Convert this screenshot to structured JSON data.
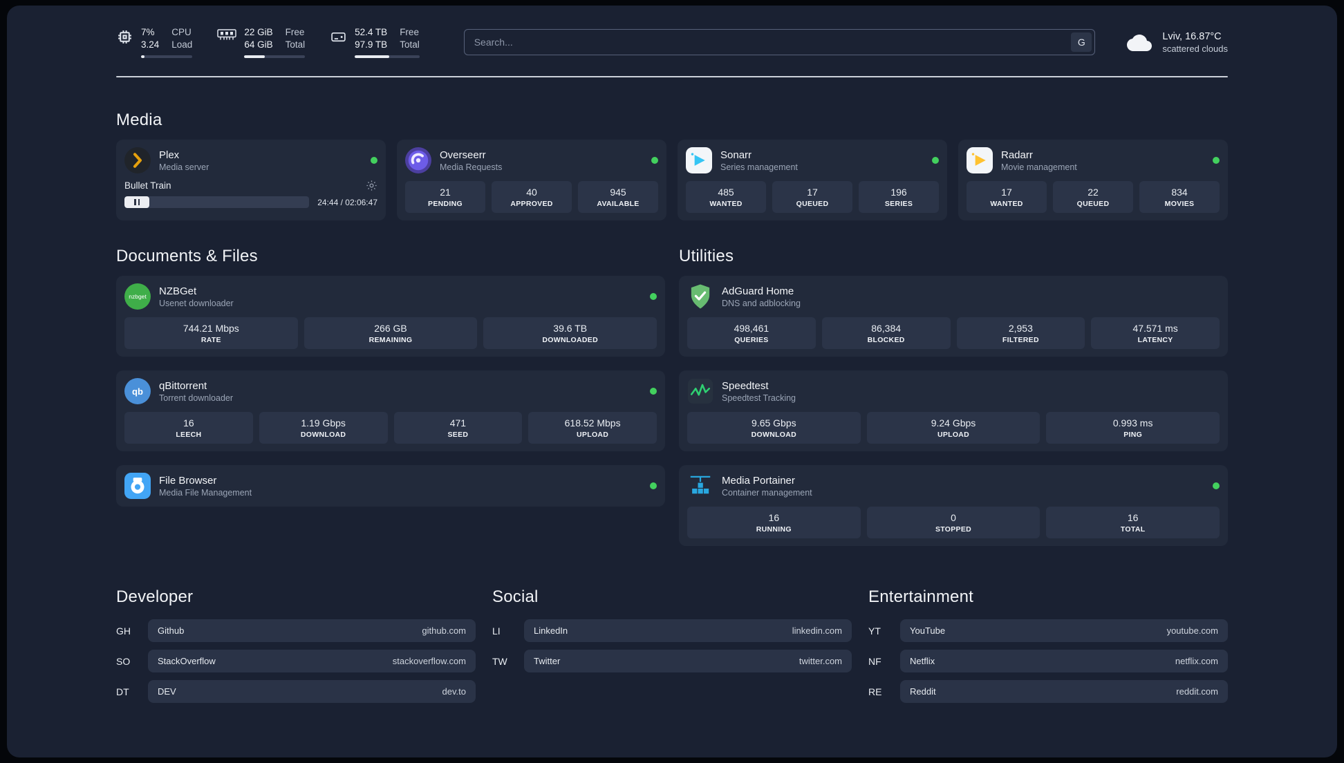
{
  "header": {
    "cpu": {
      "value1": "7%",
      "value2": "3.24",
      "label1": "CPU",
      "label2": "Load",
      "bar_percent": 7
    },
    "ram": {
      "value1": "22 GiB",
      "value2": "64 GiB",
      "label1": "Free",
      "label2": "Total",
      "bar_percent": 34
    },
    "disk": {
      "value1": "52.4 TB",
      "value2": "97.9 TB",
      "label1": "Free",
      "label2": "Total",
      "bar_percent": 53
    },
    "search": {
      "placeholder": "Search...",
      "button_label": "G"
    },
    "weather": {
      "location": "Lviv, 16.87°C",
      "condition": "scattered clouds"
    }
  },
  "media": {
    "title": "Media",
    "plex": {
      "name": "Plex",
      "subtitle": "Media server",
      "now_playing": "Bullet Train",
      "time": "24:44 / 02:06:47"
    },
    "overseerr": {
      "name": "Overseerr",
      "subtitle": "Media Requests",
      "stats": [
        {
          "value": "21",
          "label": "PENDING"
        },
        {
          "value": "40",
          "label": "APPROVED"
        },
        {
          "value": "945",
          "label": "AVAILABLE"
        }
      ]
    },
    "sonarr": {
      "name": "Sonarr",
      "subtitle": "Series management",
      "stats": [
        {
          "value": "485",
          "label": "WANTED"
        },
        {
          "value": "17",
          "label": "QUEUED"
        },
        {
          "value": "196",
          "label": "SERIES"
        }
      ]
    },
    "radarr": {
      "name": "Radarr",
      "subtitle": "Movie management",
      "stats": [
        {
          "value": "17",
          "label": "WANTED"
        },
        {
          "value": "22",
          "label": "QUEUED"
        },
        {
          "value": "834",
          "label": "MOVIES"
        }
      ]
    }
  },
  "documents": {
    "title": "Documents & Files",
    "nzbget": {
      "name": "NZBGet",
      "subtitle": "Usenet downloader",
      "icon_text": "nzbget",
      "stats": [
        {
          "value": "744.21 Mbps",
          "label": "RATE"
        },
        {
          "value": "266 GB",
          "label": "REMAINING"
        },
        {
          "value": "39.6 TB",
          "label": "DOWNLOADED"
        }
      ]
    },
    "qbittorrent": {
      "name": "qBittorrent",
      "subtitle": "Torrent downloader",
      "icon_text": "qb",
      "stats": [
        {
          "value": "16",
          "label": "LEECH"
        },
        {
          "value": "1.19 Gbps",
          "label": "DOWNLOAD"
        },
        {
          "value": "471",
          "label": "SEED"
        },
        {
          "value": "618.52 Mbps",
          "label": "UPLOAD"
        }
      ]
    },
    "filebrowser": {
      "name": "File Browser",
      "subtitle": "Media File Management"
    }
  },
  "utilities": {
    "title": "Utilities",
    "adguard": {
      "name": "AdGuard Home",
      "subtitle": "DNS and adblocking",
      "stats": [
        {
          "value": "498,461",
          "label": "QUERIES"
        },
        {
          "value": "86,384",
          "label": "BLOCKED"
        },
        {
          "value": "2,953",
          "label": "FILTERED"
        },
        {
          "value": "47.571 ms",
          "label": "LATENCY"
        }
      ]
    },
    "speedtest": {
      "name": "Speedtest",
      "subtitle": "Speedtest Tracking",
      "stats": [
        {
          "value": "9.65 Gbps",
          "label": "DOWNLOAD"
        },
        {
          "value": "9.24 Gbps",
          "label": "UPLOAD"
        },
        {
          "value": "0.993 ms",
          "label": "PING"
        }
      ]
    },
    "portainer": {
      "name": "Media Portainer",
      "subtitle": "Container management",
      "stats": [
        {
          "value": "16",
          "label": "RUNNING"
        },
        {
          "value": "0",
          "label": "STOPPED"
        },
        {
          "value": "16",
          "label": "TOTAL"
        }
      ]
    }
  },
  "bookmarks": {
    "developer": {
      "title": "Developer",
      "items": [
        {
          "abbr": "GH",
          "name": "Github",
          "url": "github.com"
        },
        {
          "abbr": "SO",
          "name": "StackOverflow",
          "url": "stackoverflow.com"
        },
        {
          "abbr": "DT",
          "name": "DEV",
          "url": "dev.to"
        }
      ]
    },
    "social": {
      "title": "Social",
      "items": [
        {
          "abbr": "LI",
          "name": "LinkedIn",
          "url": "linkedin.com"
        },
        {
          "abbr": "TW",
          "name": "Twitter",
          "url": "twitter.com"
        }
      ]
    },
    "entertainment": {
      "title": "Entertainment",
      "items": [
        {
          "abbr": "YT",
          "name": "YouTube",
          "url": "youtube.com"
        },
        {
          "abbr": "NF",
          "name": "Netflix",
          "url": "netflix.com"
        },
        {
          "abbr": "RE",
          "name": "Reddit",
          "url": "reddit.com"
        }
      ]
    }
  },
  "colors": {
    "status_online": "#43d05e",
    "plex_gold": "#e5a00d",
    "sonarr_blue": "#35c5f4",
    "radarr_yellow": "#ffc230",
    "nzbget_green": "#3fae49",
    "qbittorrent_blue": "#4a90d9",
    "adguard_green": "#68bc71",
    "speedtest_green": "#2fd072",
    "portainer_blue": "#29a8e0",
    "filebrowser_blue": "#42a5f5",
    "overseerr_purple": "#6d5ce8"
  }
}
